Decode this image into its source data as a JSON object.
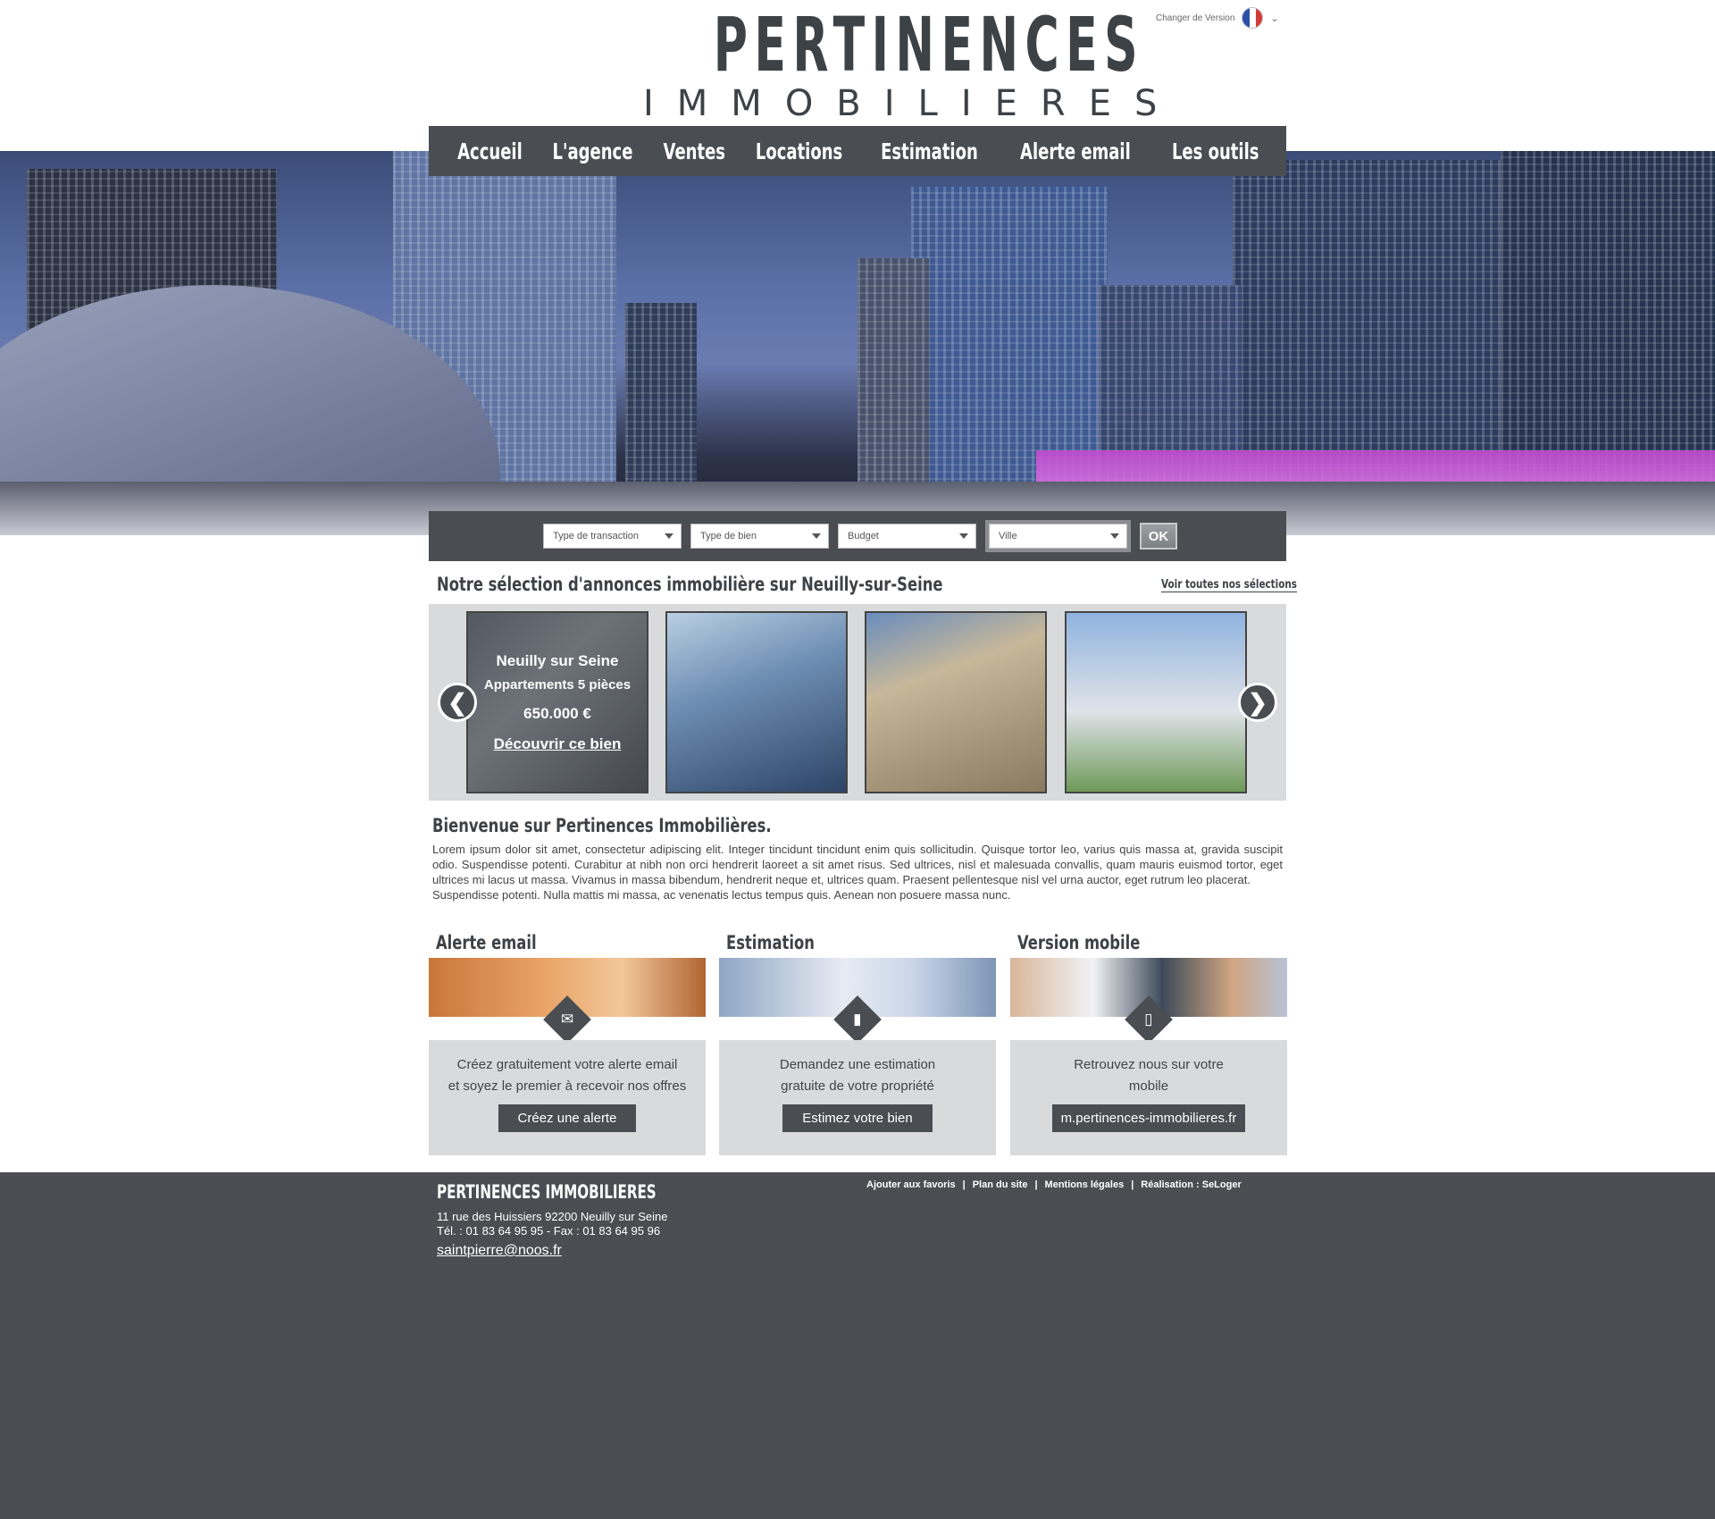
{
  "header": {
    "logo_line1": "PERTINENCES",
    "logo_line2": "IMMOBILIERES",
    "version_label": "Changer de Version"
  },
  "nav": {
    "items": [
      "Accueil",
      "L'agence",
      "Ventes",
      "Locations",
      "Estimation",
      "Alerte email",
      "Les outils"
    ]
  },
  "search": {
    "transaction": "Type de transaction",
    "bien": "Type de bien",
    "budget": "Budget",
    "ville": "Ville",
    "ok": "OK"
  },
  "selection": {
    "title": "Notre sélection d'annonces immobilière sur Neuilly-sur-Seine",
    "see_all": "Voir toutes nos sélections",
    "featured": {
      "city": "Neuilly sur Seine",
      "type": "Appartements 5 pièces",
      "price": "650.000 €",
      "cta": "Découvrir ce bien"
    },
    "prev": "❮",
    "next": "❯"
  },
  "welcome": {
    "title": "Bienvenue sur Pertinences Immobilières.",
    "text1": "Lorem ipsum dolor sit amet, consectetur adipiscing elit. Integer tincidunt tincidunt enim quis sollicitudin. Quisque tortor leo, varius quis massa at, gravida suscipit odio. Suspendisse potenti. Curabitur at nibh non orci hendrerit laoreet a sit amet risus. Sed ultrices, nisl et malesuada convallis, quam mauris euismod tortor, eget ultrices mi lacus ut massa. Vivamus in massa bibendum, hendrerit neque et, ultrices quam. Praesent pellentesque nisl vel urna auctor, eget rutrum leo placerat.",
    "text2": "Suspendisse potenti. Nulla mattis mi massa, ac venenatis lectus tempus quis. Aenean non posuere massa nunc."
  },
  "features": {
    "alerte": {
      "title": "Alerte email",
      "line1": "Créez gratuitement votre alerte email",
      "line2": "et soyez le premier à recevoir nos offres",
      "button": "Créez une alerte"
    },
    "estimation": {
      "title": "Estimation",
      "line1": "Demandez une estimation",
      "line2": "gratuite de votre propriété",
      "button": "Estimez votre bien"
    },
    "mobile": {
      "title": "Version mobile",
      "line1": "Retrouvez nous sur votre",
      "line2": "mobile",
      "button": "m.pertinences-immobilieres.fr"
    }
  },
  "footer": {
    "name": "PERTINENCES IMMOBILIERES",
    "address": "11 rue des Huissiers 92200 Neuilly sur Seine",
    "phone": "Tél. : 01 83 64 95 95 - Fax : 01 83 64 95 96",
    "email": "saintpierre@noos.fr",
    "links": [
      "Ajouter aux favoris",
      "Plan du site",
      "Mentions légales",
      "Réalisation : SeLoger"
    ],
    "separator": "|"
  },
  "colors": {
    "dark": "#4a4e52",
    "panel": "#d8dadc"
  }
}
